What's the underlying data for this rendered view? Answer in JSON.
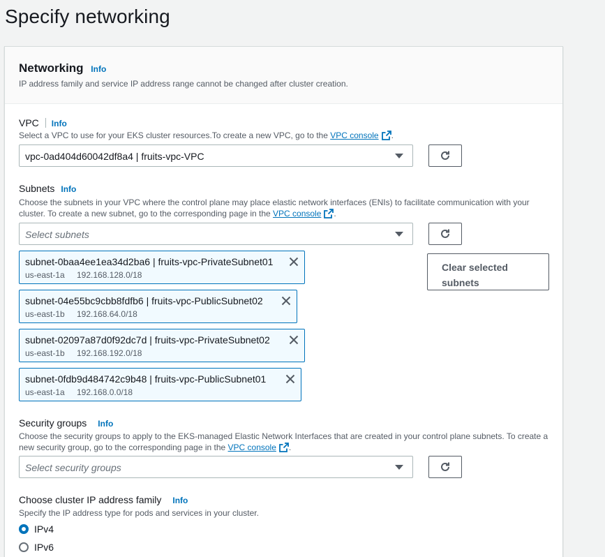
{
  "page": {
    "title": "Specify networking"
  },
  "networking": {
    "title": "Networking",
    "info": "Info",
    "description": "IP address family and service IP address range cannot be changed after cluster creation."
  },
  "vpc": {
    "label": "VPC",
    "info": "Info",
    "description": "Select a VPC to use for your EKS cluster resources.To create a new VPC, go to the ",
    "link": "VPC console",
    "suffix": ".",
    "selected": "vpc-0ad404d60042df8a4 | fruits-vpc-VPC"
  },
  "subnets": {
    "label": "Subnets",
    "info": "Info",
    "description": "Choose the subnets in your VPC where the control plane may place elastic network interfaces (ENIs) to facilitate communication with your cluster. To create a new subnet, go to the corresponding page in the ",
    "link": "VPC console",
    "suffix": ".",
    "placeholder": "Select subnets",
    "clear_label": "Clear selected subnets",
    "tokens": [
      {
        "name": "subnet-0baa4ee1ea34d2ba6 | fruits-vpc-PrivateSubnet01",
        "az": "us-east-1a",
        "cidr": "192.168.128.0/18"
      },
      {
        "name": "subnet-04e55bc9cbb8fdfb6 | fruits-vpc-PublicSubnet02",
        "az": "us-east-1b",
        "cidr": "192.168.64.0/18"
      },
      {
        "name": "subnet-02097a87d0f92dc7d | fruits-vpc-PrivateSubnet02",
        "az": "us-east-1b",
        "cidr": "192.168.192.0/18"
      },
      {
        "name": "subnet-0fdb9d484742c9b48 | fruits-vpc-PublicSubnet01",
        "az": "us-east-1a",
        "cidr": "192.168.0.0/18"
      }
    ]
  },
  "security_groups": {
    "label": "Security groups",
    "info": "Info",
    "description": "Choose the security groups to apply to the EKS-managed Elastic Network Interfaces that are created in your control plane subnets. To create a new security group, go to the corresponding page in the ",
    "link": "VPC console",
    "suffix": ".",
    "placeholder": "Select security groups"
  },
  "ip_family": {
    "label": "Choose cluster IP address family",
    "info": "Info",
    "description": "Specify the IP address type for pods and services in your cluster.",
    "options": [
      {
        "label": "IPv4",
        "checked": true
      },
      {
        "label": "IPv6",
        "checked": false
      }
    ]
  },
  "colors": {
    "link": "#0073bb",
    "token_bg": "#f1faff",
    "text": "#16191f",
    "muted": "#545b64"
  }
}
